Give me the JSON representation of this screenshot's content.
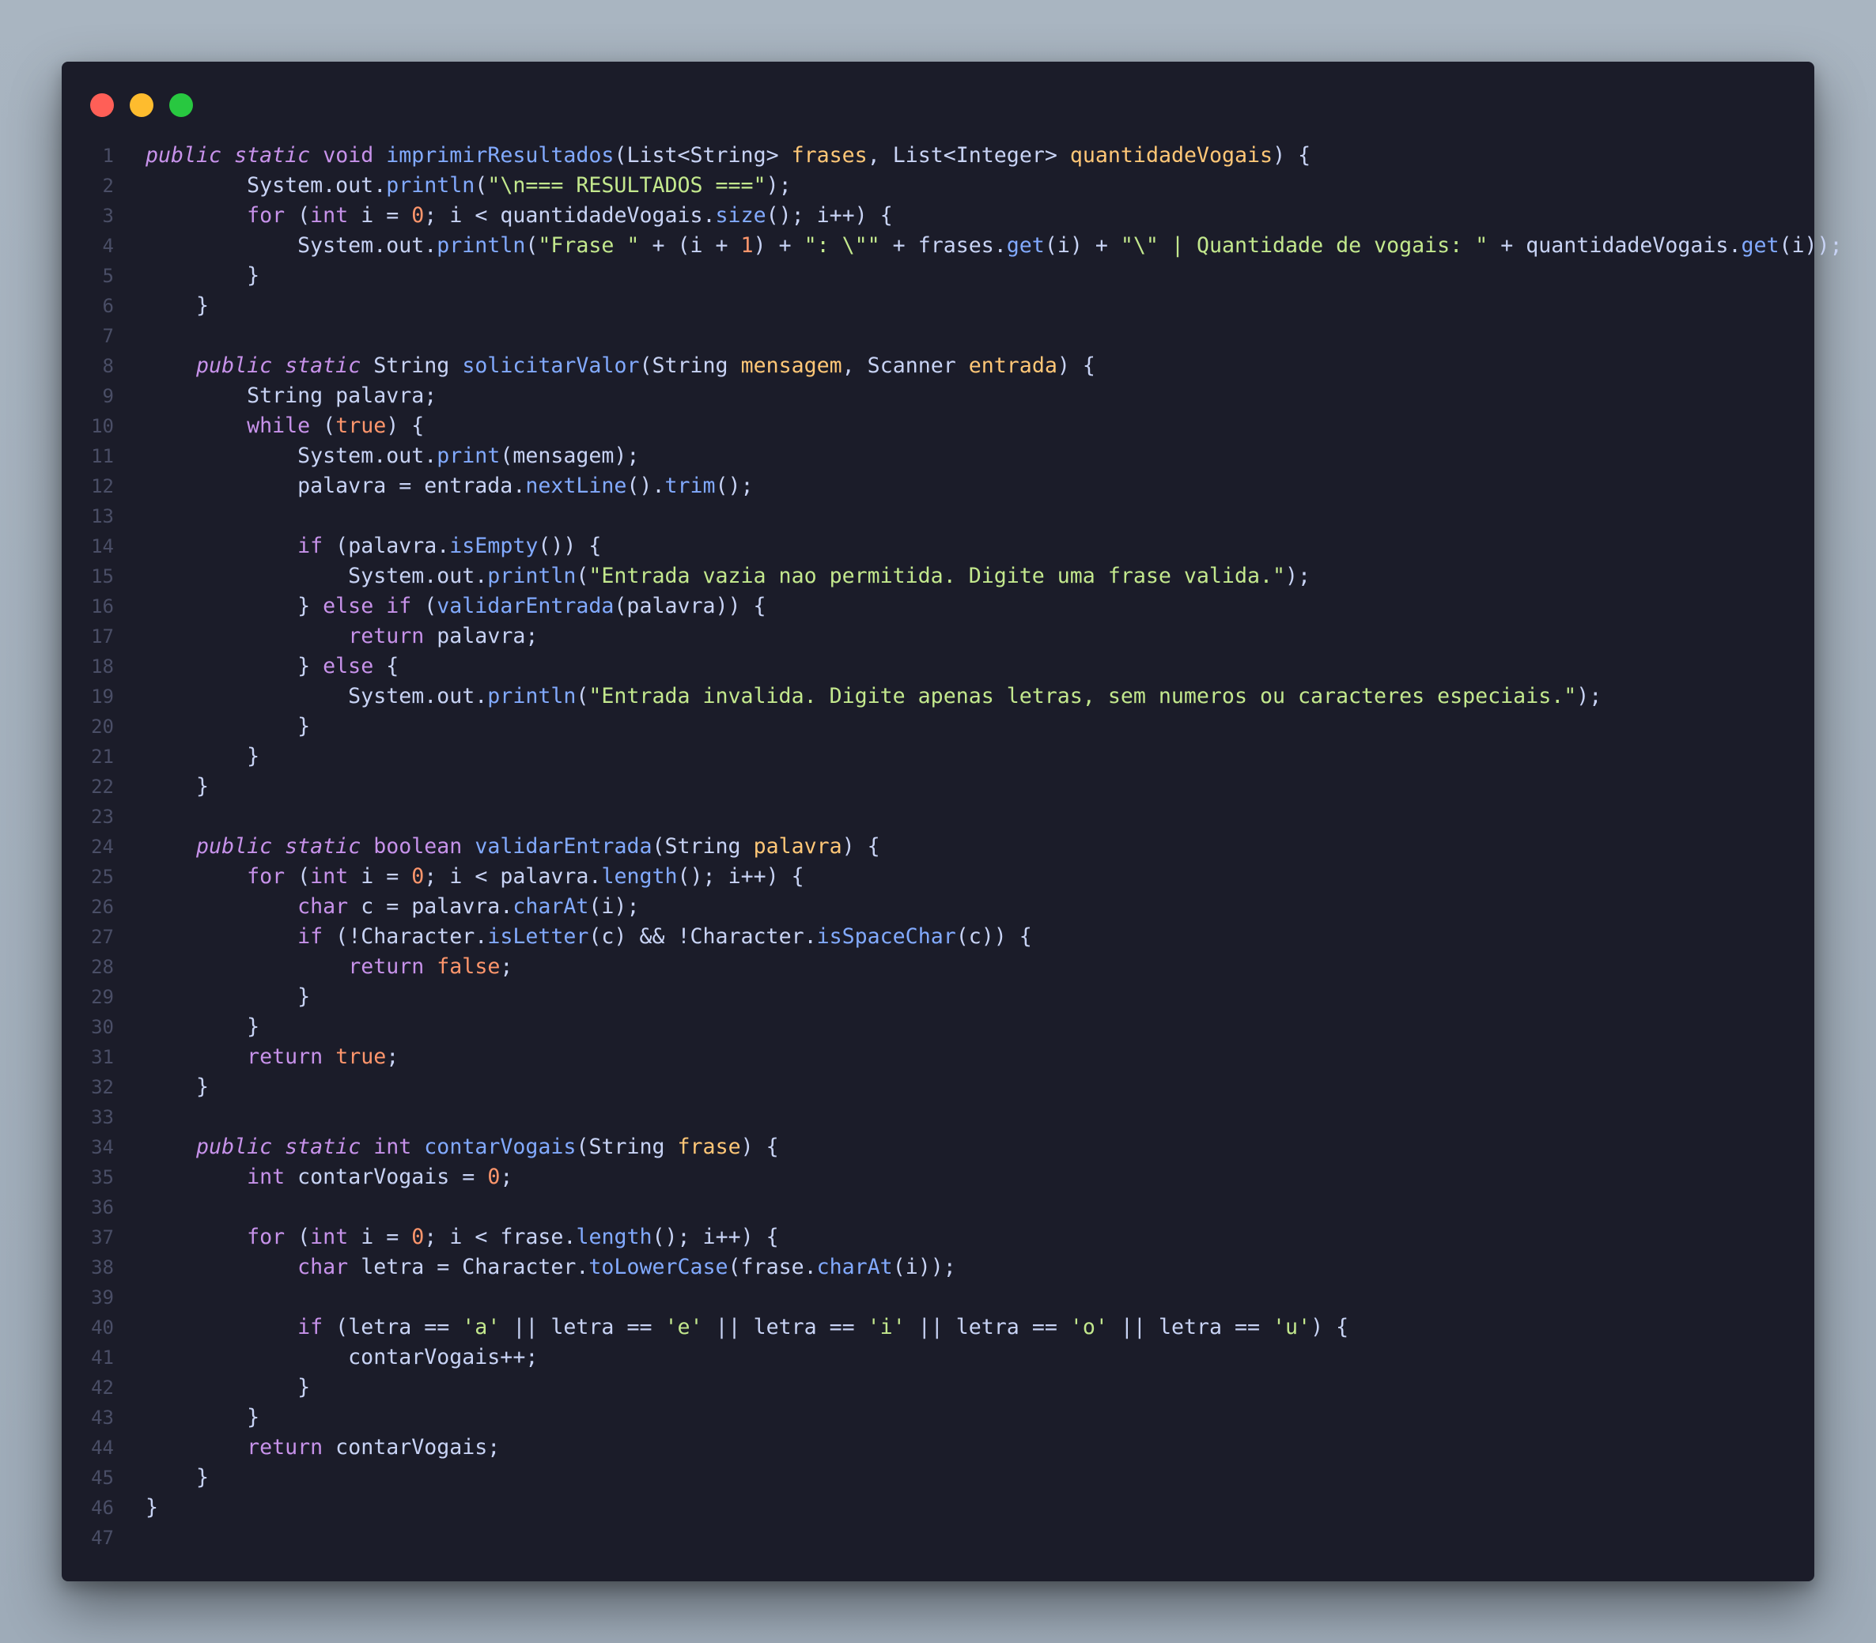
{
  "window": {
    "controls": [
      "close",
      "minimize",
      "maximize"
    ],
    "colors": {
      "close": "#ff5f57",
      "minimize": "#febc2e",
      "maximize": "#28c840",
      "background": "#1b1c29"
    }
  },
  "code": {
    "language": "java",
    "lines": [
      {
        "n": "1",
        "t": [
          [
            "it",
            "public"
          ],
          [
            "txt",
            " "
          ],
          [
            "it",
            "static"
          ],
          [
            "txt",
            " "
          ],
          [
            "k",
            "void"
          ],
          [
            "txt",
            " "
          ],
          [
            "f",
            "imprimirResultados"
          ],
          [
            "txt",
            "(List<String> "
          ],
          [
            "p",
            "frases"
          ],
          [
            "txt",
            ", List<Integer> "
          ],
          [
            "p",
            "quantidadeVogais"
          ],
          [
            "txt",
            ") {"
          ]
        ]
      },
      {
        "n": "2",
        "t": [
          [
            "txt",
            "        System.out."
          ],
          [
            "f",
            "println"
          ],
          [
            "txt",
            "("
          ],
          [
            "s",
            "\"\\n=== RESULTADOS ===\""
          ],
          [
            "txt",
            ");"
          ]
        ]
      },
      {
        "n": "3",
        "t": [
          [
            "txt",
            "        "
          ],
          [
            "k",
            "for"
          ],
          [
            "txt",
            " ("
          ],
          [
            "k",
            "int"
          ],
          [
            "txt",
            " i = "
          ],
          [
            "n",
            "0"
          ],
          [
            "txt",
            "; i < quantidadeVogais."
          ],
          [
            "f",
            "size"
          ],
          [
            "txt",
            "(); i++) {"
          ]
        ]
      },
      {
        "n": "4",
        "t": [
          [
            "txt",
            "            System.out."
          ],
          [
            "f",
            "println"
          ],
          [
            "txt",
            "("
          ],
          [
            "s",
            "\"Frase \""
          ],
          [
            "txt",
            " + (i + "
          ],
          [
            "n",
            "1"
          ],
          [
            "txt",
            ") + "
          ],
          [
            "s",
            "\": \\\"\""
          ],
          [
            "txt",
            " + frases."
          ],
          [
            "f",
            "get"
          ],
          [
            "txt",
            "(i) + "
          ],
          [
            "s",
            "\"\\\" | Quantidade de vogais: \""
          ],
          [
            "txt",
            " + quantidadeVogais."
          ],
          [
            "f",
            "get"
          ],
          [
            "txt",
            "(i));"
          ]
        ]
      },
      {
        "n": "5",
        "t": [
          [
            "txt",
            "        }"
          ]
        ]
      },
      {
        "n": "6",
        "t": [
          [
            "txt",
            "    }"
          ]
        ]
      },
      {
        "n": "7",
        "t": []
      },
      {
        "n": "8",
        "t": [
          [
            "txt",
            "    "
          ],
          [
            "it",
            "public"
          ],
          [
            "txt",
            " "
          ],
          [
            "it",
            "static"
          ],
          [
            "txt",
            " String "
          ],
          [
            "f",
            "solicitarValor"
          ],
          [
            "txt",
            "(String "
          ],
          [
            "p",
            "mensagem"
          ],
          [
            "txt",
            ", Scanner "
          ],
          [
            "p",
            "entrada"
          ],
          [
            "txt",
            ") {"
          ]
        ]
      },
      {
        "n": "9",
        "t": [
          [
            "txt",
            "        String palavra;"
          ]
        ]
      },
      {
        "n": "10",
        "t": [
          [
            "txt",
            "        "
          ],
          [
            "k",
            "while"
          ],
          [
            "txt",
            " ("
          ],
          [
            "n",
            "true"
          ],
          [
            "txt",
            ") {"
          ]
        ]
      },
      {
        "n": "11",
        "t": [
          [
            "txt",
            "            System.out."
          ],
          [
            "f",
            "print"
          ],
          [
            "txt",
            "(mensagem);"
          ]
        ]
      },
      {
        "n": "12",
        "t": [
          [
            "txt",
            "            palavra = entrada."
          ],
          [
            "f",
            "nextLine"
          ],
          [
            "txt",
            "()."
          ],
          [
            "f",
            "trim"
          ],
          [
            "txt",
            "();"
          ]
        ]
      },
      {
        "n": "13",
        "t": []
      },
      {
        "n": "14",
        "t": [
          [
            "txt",
            "            "
          ],
          [
            "k",
            "if"
          ],
          [
            "txt",
            " (palavra."
          ],
          [
            "f",
            "isEmpty"
          ],
          [
            "txt",
            "()) {"
          ]
        ]
      },
      {
        "n": "15",
        "t": [
          [
            "txt",
            "                System.out."
          ],
          [
            "f",
            "println"
          ],
          [
            "txt",
            "("
          ],
          [
            "s",
            "\"Entrada vazia nao permitida. Digite uma frase valida.\""
          ],
          [
            "txt",
            ");"
          ]
        ]
      },
      {
        "n": "16",
        "t": [
          [
            "txt",
            "            } "
          ],
          [
            "k",
            "else if"
          ],
          [
            "txt",
            " ("
          ],
          [
            "f",
            "validarEntrada"
          ],
          [
            "txt",
            "(palavra)) {"
          ]
        ]
      },
      {
        "n": "17",
        "t": [
          [
            "txt",
            "                "
          ],
          [
            "k",
            "return"
          ],
          [
            "txt",
            " palavra;"
          ]
        ]
      },
      {
        "n": "18",
        "t": [
          [
            "txt",
            "            } "
          ],
          [
            "k",
            "else"
          ],
          [
            "txt",
            " {"
          ]
        ]
      },
      {
        "n": "19",
        "t": [
          [
            "txt",
            "                System.out."
          ],
          [
            "f",
            "println"
          ],
          [
            "txt",
            "("
          ],
          [
            "s",
            "\"Entrada invalida. Digite apenas letras, sem numeros ou caracteres especiais.\""
          ],
          [
            "txt",
            ");"
          ]
        ]
      },
      {
        "n": "20",
        "t": [
          [
            "txt",
            "            }"
          ]
        ]
      },
      {
        "n": "21",
        "t": [
          [
            "txt",
            "        }"
          ]
        ]
      },
      {
        "n": "22",
        "t": [
          [
            "txt",
            "    }"
          ]
        ]
      },
      {
        "n": "23",
        "t": []
      },
      {
        "n": "24",
        "t": [
          [
            "txt",
            "    "
          ],
          [
            "it",
            "public"
          ],
          [
            "txt",
            " "
          ],
          [
            "it",
            "static"
          ],
          [
            "txt",
            " "
          ],
          [
            "k",
            "boolean"
          ],
          [
            "txt",
            " "
          ],
          [
            "f",
            "validarEntrada"
          ],
          [
            "txt",
            "(String "
          ],
          [
            "p",
            "palavra"
          ],
          [
            "txt",
            ") {"
          ]
        ]
      },
      {
        "n": "25",
        "t": [
          [
            "txt",
            "        "
          ],
          [
            "k",
            "for"
          ],
          [
            "txt",
            " ("
          ],
          [
            "k",
            "int"
          ],
          [
            "txt",
            " i = "
          ],
          [
            "n",
            "0"
          ],
          [
            "txt",
            "; i < palavra."
          ],
          [
            "f",
            "length"
          ],
          [
            "txt",
            "(); i++) {"
          ]
        ]
      },
      {
        "n": "26",
        "t": [
          [
            "txt",
            "            "
          ],
          [
            "k",
            "char"
          ],
          [
            "txt",
            " c = palavra."
          ],
          [
            "f",
            "charAt"
          ],
          [
            "txt",
            "(i);"
          ]
        ]
      },
      {
        "n": "27",
        "t": [
          [
            "txt",
            "            "
          ],
          [
            "k",
            "if"
          ],
          [
            "txt",
            " (!Character."
          ],
          [
            "f",
            "isLetter"
          ],
          [
            "txt",
            "(c) && !Character."
          ],
          [
            "f",
            "isSpaceChar"
          ],
          [
            "txt",
            "(c)) {"
          ]
        ]
      },
      {
        "n": "28",
        "t": [
          [
            "txt",
            "                "
          ],
          [
            "k",
            "return"
          ],
          [
            "txt",
            " "
          ],
          [
            "n",
            "false"
          ],
          [
            "txt",
            ";"
          ]
        ]
      },
      {
        "n": "29",
        "t": [
          [
            "txt",
            "            }"
          ]
        ]
      },
      {
        "n": "30",
        "t": [
          [
            "txt",
            "        }"
          ]
        ]
      },
      {
        "n": "31",
        "t": [
          [
            "txt",
            "        "
          ],
          [
            "k",
            "return"
          ],
          [
            "txt",
            " "
          ],
          [
            "n",
            "true"
          ],
          [
            "txt",
            ";"
          ]
        ]
      },
      {
        "n": "32",
        "t": [
          [
            "txt",
            "    }"
          ]
        ]
      },
      {
        "n": "33",
        "t": []
      },
      {
        "n": "34",
        "t": [
          [
            "txt",
            "    "
          ],
          [
            "it",
            "public"
          ],
          [
            "txt",
            " "
          ],
          [
            "it",
            "static"
          ],
          [
            "txt",
            " "
          ],
          [
            "k",
            "int"
          ],
          [
            "txt",
            " "
          ],
          [
            "f",
            "contarVogais"
          ],
          [
            "txt",
            "(String "
          ],
          [
            "p",
            "frase"
          ],
          [
            "txt",
            ") {"
          ]
        ]
      },
      {
        "n": "35",
        "t": [
          [
            "txt",
            "        "
          ],
          [
            "k",
            "int"
          ],
          [
            "txt",
            " contarVogais = "
          ],
          [
            "n",
            "0"
          ],
          [
            "txt",
            ";"
          ]
        ]
      },
      {
        "n": "36",
        "t": []
      },
      {
        "n": "37",
        "t": [
          [
            "txt",
            "        "
          ],
          [
            "k",
            "for"
          ],
          [
            "txt",
            " ("
          ],
          [
            "k",
            "int"
          ],
          [
            "txt",
            " i = "
          ],
          [
            "n",
            "0"
          ],
          [
            "txt",
            "; i < frase."
          ],
          [
            "f",
            "length"
          ],
          [
            "txt",
            "(); i++) {"
          ]
        ]
      },
      {
        "n": "38",
        "t": [
          [
            "txt",
            "            "
          ],
          [
            "k",
            "char"
          ],
          [
            "txt",
            " letra = Character."
          ],
          [
            "f",
            "toLowerCase"
          ],
          [
            "txt",
            "(frase."
          ],
          [
            "f",
            "charAt"
          ],
          [
            "txt",
            "(i));"
          ]
        ]
      },
      {
        "n": "39",
        "t": []
      },
      {
        "n": "40",
        "t": [
          [
            "txt",
            "            "
          ],
          [
            "k",
            "if"
          ],
          [
            "txt",
            " (letra == "
          ],
          [
            "s",
            "'a'"
          ],
          [
            "txt",
            " || letra == "
          ],
          [
            "s",
            "'e'"
          ],
          [
            "txt",
            " || letra == "
          ],
          [
            "s",
            "'i'"
          ],
          [
            "txt",
            " || letra == "
          ],
          [
            "s",
            "'o'"
          ],
          [
            "txt",
            " || letra == "
          ],
          [
            "s",
            "'u'"
          ],
          [
            "txt",
            ") {"
          ]
        ]
      },
      {
        "n": "41",
        "t": [
          [
            "txt",
            "                contarVogais++;"
          ]
        ]
      },
      {
        "n": "42",
        "t": [
          [
            "txt",
            "            }"
          ]
        ]
      },
      {
        "n": "43",
        "t": [
          [
            "txt",
            "        }"
          ]
        ]
      },
      {
        "n": "44",
        "t": [
          [
            "txt",
            "        "
          ],
          [
            "k",
            "return"
          ],
          [
            "txt",
            " contarVogais;"
          ]
        ]
      },
      {
        "n": "45",
        "t": [
          [
            "txt",
            "    }"
          ]
        ]
      },
      {
        "n": "46",
        "t": [
          [
            "txt",
            "}"
          ]
        ]
      },
      {
        "n": "47",
        "t": []
      }
    ]
  }
}
